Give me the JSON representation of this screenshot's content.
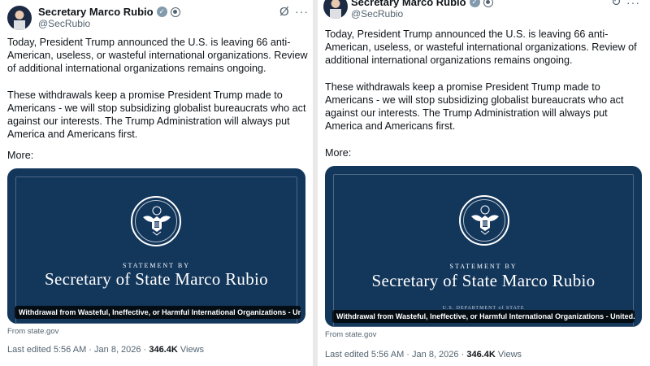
{
  "posts": [
    {
      "author": {
        "name": "Secretary Marco Rubio",
        "handle": "@SecRubio",
        "verified_mark": "✓",
        "badge_icon": "government-badge-icon",
        "verified_color": "#829aab"
      },
      "actions": {
        "grok_icon": "Ø",
        "more_icon": "···"
      },
      "body": {
        "paragraph1": "Today, President Trump announced the U.S. is leaving 66 anti-American, useless, or wasteful international organizations. Review of additional international organizations remains ongoing.",
        "paragraph2": "These withdrawals keep a promise President Trump made to Americans - we will stop subsidizing globalist bureaucrats who act against our interests. The Trump Administration will always put America and Americans first."
      },
      "more_label": "More:",
      "card": {
        "statement_by": "STATEMENT BY",
        "title": "Secretary of State Marco Rubio",
        "caption": "Withdrawal from Wasteful, Ineffective, or Harmful International Organizations - United...",
        "background_color": "#13365b"
      },
      "source": "From state.gov",
      "meta": {
        "edited": "Last edited 5:56 AM",
        "separator": "·",
        "date": "Jan 8, 2026",
        "views_count": "346.4K",
        "views_label": "Views"
      }
    },
    {
      "author": {
        "name": "Secretary Marco Rubio",
        "handle": "@SecRubio",
        "verified_mark": "✓",
        "badge_icon": "government-badge-icon",
        "verified_color": "#829aab"
      },
      "actions": {
        "grok_icon": "↻",
        "more_icon": "···"
      },
      "body": {
        "paragraph1": "Today, President Trump announced the U.S. is leaving 66 anti-American, useless, or wasteful international organizations. Review of additional international organizations remains ongoing.",
        "paragraph2": "These withdrawals keep a promise President Trump made to Americans - we will stop subsidizing globalist bureaucrats who act against our interests. The Trump Administration will always put America and Americans first."
      },
      "more_label": "More:",
      "card": {
        "statement_by": "STATEMENT BY",
        "title": "Secretary of State Marco Rubio",
        "department": "U.S. DEPARTMENT of STATE",
        "caption": "Withdrawal from Wasteful, Ineffective, or Harmful International Organizations - United...",
        "background_color": "#13365b"
      },
      "source": "From state.gov",
      "meta": {
        "edited": "Last edited 5:56 AM",
        "separator": "·",
        "date": "Jan 8, 2026",
        "views_count": "346.4K",
        "views_label": "Views"
      }
    }
  ]
}
